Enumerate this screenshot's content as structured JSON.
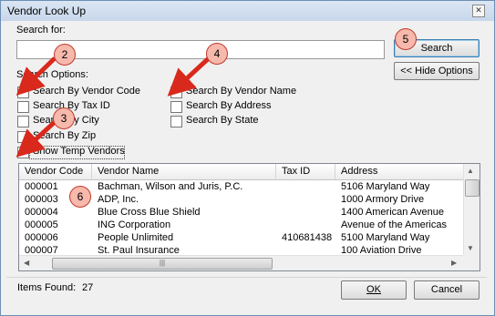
{
  "window": {
    "title": "Vendor Look Up",
    "close_glyph": "✕"
  },
  "search": {
    "label": "Search for:",
    "value": "",
    "placeholder": ""
  },
  "options": {
    "group_label": "Search Options:",
    "checkboxes": [
      {
        "label": "Search By Vendor Code",
        "checked": false
      },
      {
        "label": "Search By Tax ID",
        "checked": false
      },
      {
        "label": "Search By City",
        "checked": false
      },
      {
        "label": "Search By Zip",
        "checked": false
      },
      {
        "label": "Search By Vendor Name",
        "checked": true
      },
      {
        "label": "Search By Address",
        "checked": false
      },
      {
        "label": "Search By State",
        "checked": false
      },
      {
        "label": "Show Temp Vendors",
        "checked": true
      }
    ]
  },
  "buttons": {
    "search": "Search",
    "hide_options": "<< Hide Options",
    "ok": "OK",
    "cancel": "Cancel"
  },
  "table": {
    "columns": [
      "Vendor Code",
      "Vendor Name",
      "Tax ID",
      "Address"
    ],
    "rows": [
      {
        "code": "000001",
        "name": "Bachman, Wilson and Juris, P.C.",
        "tax_id": "",
        "address": "5106 Maryland Way"
      },
      {
        "code": "000003",
        "name": "ADP, Inc.",
        "tax_id": "",
        "address": "1000 Armory Drive"
      },
      {
        "code": "000004",
        "name": "Blue Cross Blue Shield",
        "tax_id": "",
        "address": "1400 American Avenue"
      },
      {
        "code": "000005",
        "name": "ING Corporation",
        "tax_id": "",
        "address": "Avenue of the Americas"
      },
      {
        "code": "000006",
        "name": "People Unlimited",
        "tax_id": "410681438",
        "address": "5100 Maryland Way"
      },
      {
        "code": "000007",
        "name": "St. Paul Insurance",
        "tax_id": "",
        "address": "100 Aviation Drive"
      }
    ]
  },
  "status": {
    "items_found_label": "Items Found:",
    "items_found_value": "27"
  },
  "annotations": {
    "b1": "2",
    "b2": "4",
    "b3": "3",
    "b4": "5",
    "b5": "6"
  },
  "scroll_glyphs": {
    "up": "▲",
    "down": "▼",
    "left": "◀",
    "right": "▶",
    "grip": "|||"
  },
  "colors": {
    "arrow": "#d9291c",
    "bubble_fill": "#f6b9ac",
    "bubble_border": "#c0392b",
    "titlebar": "#c7d7ea"
  }
}
